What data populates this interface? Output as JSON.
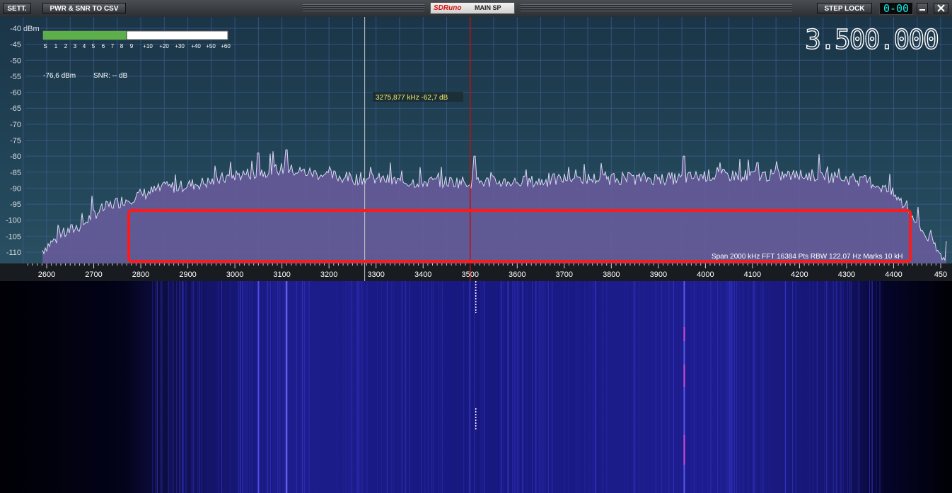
{
  "toolbar": {
    "settings_label": "SETT.",
    "csv_label": "PWR & SNR TO CSV",
    "logo_text": "SDRuno",
    "panel_label": "MAIN SP",
    "step_lock_label": "STEP LOCK",
    "counter": "0-00",
    "minimize_icon": "minimize-icon",
    "close_icon": "close-icon"
  },
  "spectrum": {
    "frequency_display": "3.500.000",
    "dbm_unit": "dBm",
    "level_readout": "-76,6 dBm",
    "snr_readout": "SNR: -- dB",
    "cursor_readout": "3275,877 kHz -62,7 dB",
    "status_line": "Span 2000 kHz  FFT 16384 Pts  RBW 122,07 Hz  Marks 10 kH",
    "smeter_scale": [
      "S",
      "1",
      "2",
      "3",
      "4",
      "5",
      "6",
      "7",
      "8",
      "9",
      "+10",
      "+20",
      "+30",
      "+40",
      "+50",
      "+60"
    ],
    "smeter_level": "S8",
    "y_axis_labels": [
      "-40",
      "-45",
      "-50",
      "-55",
      "-60",
      "-65",
      "-70",
      "-75",
      "-80",
      "-85",
      "-90",
      "-95",
      "-100",
      "-105",
      "-110"
    ],
    "x_axis_labels": [
      "2600",
      "2700",
      "2800",
      "2900",
      "3000",
      "3100",
      "3200",
      "3300",
      "3400",
      "3500",
      "3600",
      "3700",
      "3800",
      "3900",
      "4000",
      "4100",
      "4200",
      "4300",
      "4400",
      "450"
    ],
    "cursor_khz": 3275.877,
    "tuned_khz": 3500,
    "colors": {
      "background": "#1d3b4f",
      "grid": "#3e5e96",
      "trace": "#d8d8f0",
      "fill": "#6a5c9e",
      "highlight": "#ff1a1a",
      "tuned_marker": "#c01010",
      "smeter_fill": "#5cb04a"
    }
  },
  "chart_data": {
    "type": "area",
    "xlabel": "",
    "ylabel": "",
    "xlim": [
      2560,
      4500
    ],
    "ylim": [
      -113,
      -38
    ],
    "x": [
      2560,
      2580,
      2600,
      2640,
      2680,
      2700,
      2740,
      2780,
      2800,
      2850,
      2900,
      2950,
      3000,
      3050,
      3100,
      3150,
      3200,
      3250,
      3300,
      3350,
      3400,
      3450,
      3500,
      3550,
      3600,
      3650,
      3700,
      3750,
      3800,
      3850,
      3900,
      3950,
      4000,
      4050,
      4100,
      4150,
      4200,
      4250,
      4300,
      4350,
      4380,
      4400,
      4420,
      4440,
      4460,
      4480,
      4500
    ],
    "y": [
      -113,
      -111,
      -108,
      -104,
      -101,
      -98,
      -95,
      -93,
      -92,
      -90,
      -89,
      -88,
      -86,
      -85,
      -84,
      -85,
      -86,
      -87,
      -87,
      -88,
      -88,
      -88,
      -88,
      -88,
      -88,
      -88,
      -87,
      -87,
      -87,
      -87,
      -87,
      -87,
      -86,
      -86,
      -86,
      -86,
      -86,
      -86,
      -87,
      -88,
      -90,
      -92,
      -95,
      -99,
      -103,
      -107,
      -111
    ],
    "peaks": [
      {
        "x": 3050,
        "y": -79
      },
      {
        "x": 3110,
        "y": -78
      },
      {
        "x": 3510,
        "y": -80
      },
      {
        "x": 3955,
        "y": -80
      },
      {
        "x": 4110,
        "y": -82
      }
    ]
  },
  "waterfall": {
    "colors": {
      "low": "#05051a",
      "mid": "#1b1b8a",
      "high": "#4747e8",
      "hot": "#d24dd6"
    }
  }
}
